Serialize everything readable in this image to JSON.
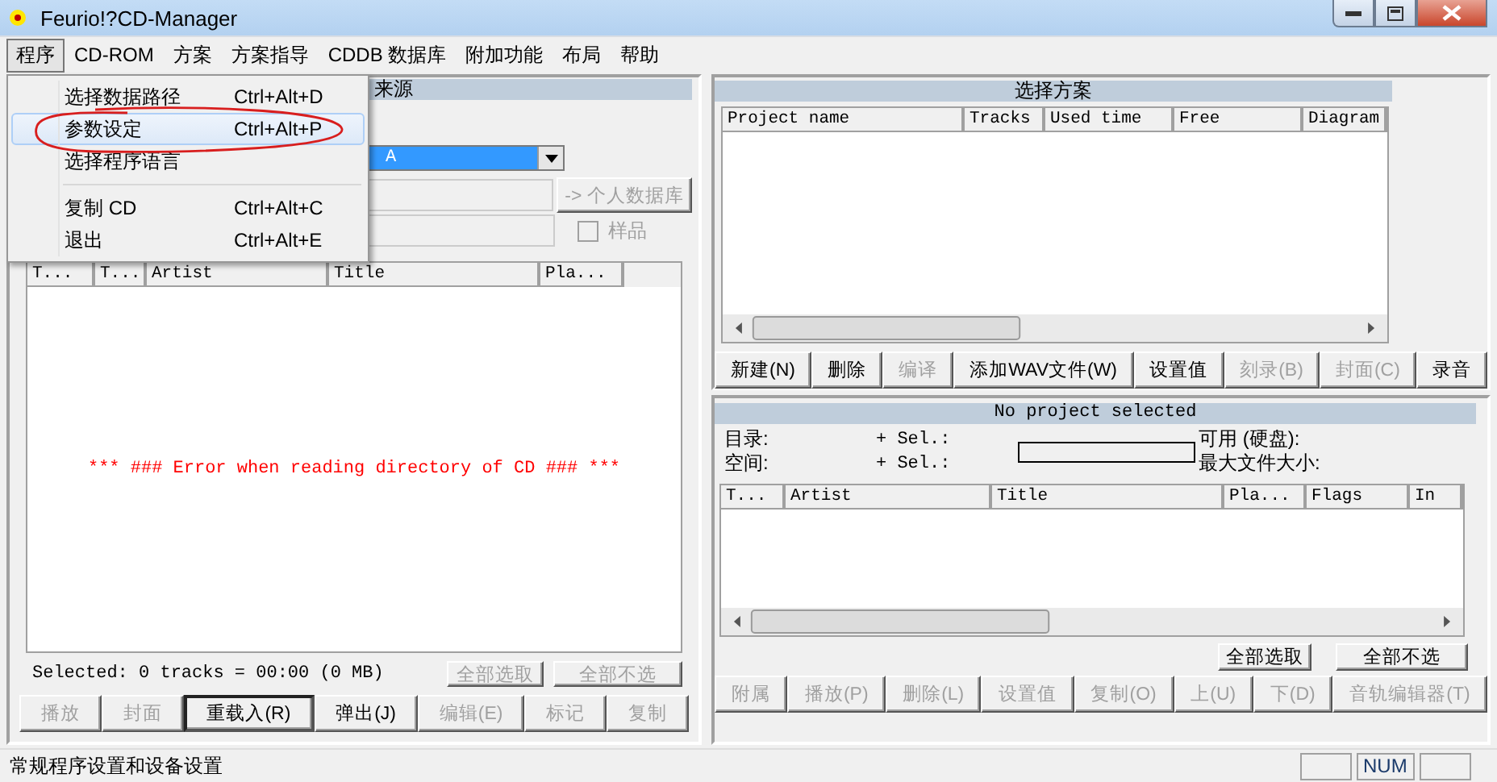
{
  "window": {
    "title": "Feurio!?CD-Manager"
  },
  "menu_bar": [
    {
      "label": "程序",
      "selected": true
    },
    {
      "label": "CD-ROM",
      "selected": false
    },
    {
      "label": "方案",
      "selected": false
    },
    {
      "label": "方案指导",
      "selected": false
    },
    {
      "label": "CDDB 数据库",
      "selected": false
    },
    {
      "label": "附加功能",
      "selected": false
    },
    {
      "label": "布局",
      "selected": false
    },
    {
      "label": "帮助",
      "selected": false
    }
  ],
  "open_menu": {
    "items": [
      {
        "kind": "item",
        "label": "选择数据路径",
        "shortcut": "Ctrl+Alt+D",
        "selected": false,
        "circled": false
      },
      {
        "kind": "item",
        "label": "参数设定",
        "shortcut": "Ctrl+Alt+P",
        "selected": true,
        "circled": true
      },
      {
        "kind": "item",
        "label": "选择程序语言",
        "selected": false,
        "circled": false
      },
      {
        "kind": "separator"
      },
      {
        "kind": "item",
        "label": "复制 CD",
        "shortcut": "Ctrl+Alt+C",
        "selected": false,
        "circled": false
      },
      {
        "kind": "item",
        "label": "退出",
        "shortcut": "Ctrl+Alt+E",
        "selected": false,
        "circled": false
      }
    ]
  },
  "source_panel": {
    "title": "来源",
    "drive": "A",
    "database_button": {
      "label": "-> 个人数据库",
      "disabled": true
    },
    "sample_checkbox": {
      "label": "样品",
      "checked": false,
      "disabled": true
    },
    "columns": [
      "T...",
      "T...",
      "Artist",
      "Title",
      "Pla..."
    ],
    "message": "*** ### Error when reading directory of CD ### ***",
    "summary": "Selected: 0 tracks = 00:00 (0 MB)",
    "select_buttons": [
      {
        "label": "全部选取",
        "disabled": true
      },
      {
        "label": "全部不选",
        "disabled": true
      }
    ],
    "buttons": [
      {
        "label": "播放",
        "disabled": true,
        "default": false
      },
      {
        "label": "封面",
        "disabled": true,
        "default": false
      },
      {
        "label": "重载入(R)",
        "disabled": false,
        "default": true
      },
      {
        "label": "弹出(J)",
        "disabled": false,
        "default": false
      },
      {
        "label": "编辑(E)",
        "disabled": true,
        "default": false
      },
      {
        "label": "标记",
        "disabled": true,
        "default": false
      },
      {
        "label": "复制",
        "disabled": true,
        "default": false
      }
    ]
  },
  "project_panel": {
    "title": "选择方案",
    "columns": [
      "Project name",
      "Tracks",
      "Used time",
      "Free",
      "Diagram"
    ],
    "buttons": [
      {
        "label": "新建(N)",
        "disabled": false
      },
      {
        "label": "删除",
        "disabled": false
      },
      {
        "label": "编译",
        "disabled": true
      },
      {
        "label": "添加WAV文件(W)",
        "disabled": false
      },
      {
        "label": "设置值",
        "disabled": false
      },
      {
        "label": "刻录(B)",
        "disabled": true
      },
      {
        "label": "封面(C)",
        "disabled": true
      },
      {
        "label": "录音",
        "disabled": false
      }
    ]
  },
  "detail_panel": {
    "title": "No project selected",
    "left_labels": [
      "目录:",
      "空间:"
    ],
    "sel_labels": [
      "+ Sel.:",
      "+ Sel.:"
    ],
    "right_labels": [
      "可用 (硬盘):",
      "最大文件大小:"
    ],
    "space_meter": {
      "level": 0
    },
    "columns": [
      "T...",
      "Artist",
      "Title",
      "Pla...",
      "Flags",
      "In"
    ],
    "select_buttons": [
      {
        "label": "全部选取",
        "disabled": false
      },
      {
        "label": "全部不选",
        "disabled": false
      }
    ],
    "buttons": [
      {
        "label": "附属",
        "disabled": true
      },
      {
        "label": "播放(P)",
        "disabled": true
      },
      {
        "label": "删除(L)",
        "disabled": true
      },
      {
        "label": "设置值",
        "disabled": true
      },
      {
        "label": "复制(O)",
        "disabled": true
      },
      {
        "label": "上(U)",
        "disabled": true
      },
      {
        "label": "下(D)",
        "disabled": true
      },
      {
        "label": "音轨编辑器(T)",
        "disabled": true
      }
    ]
  },
  "status_bar": {
    "message": "常规程序设置和设备设置",
    "indicators": [
      "NUM"
    ]
  }
}
